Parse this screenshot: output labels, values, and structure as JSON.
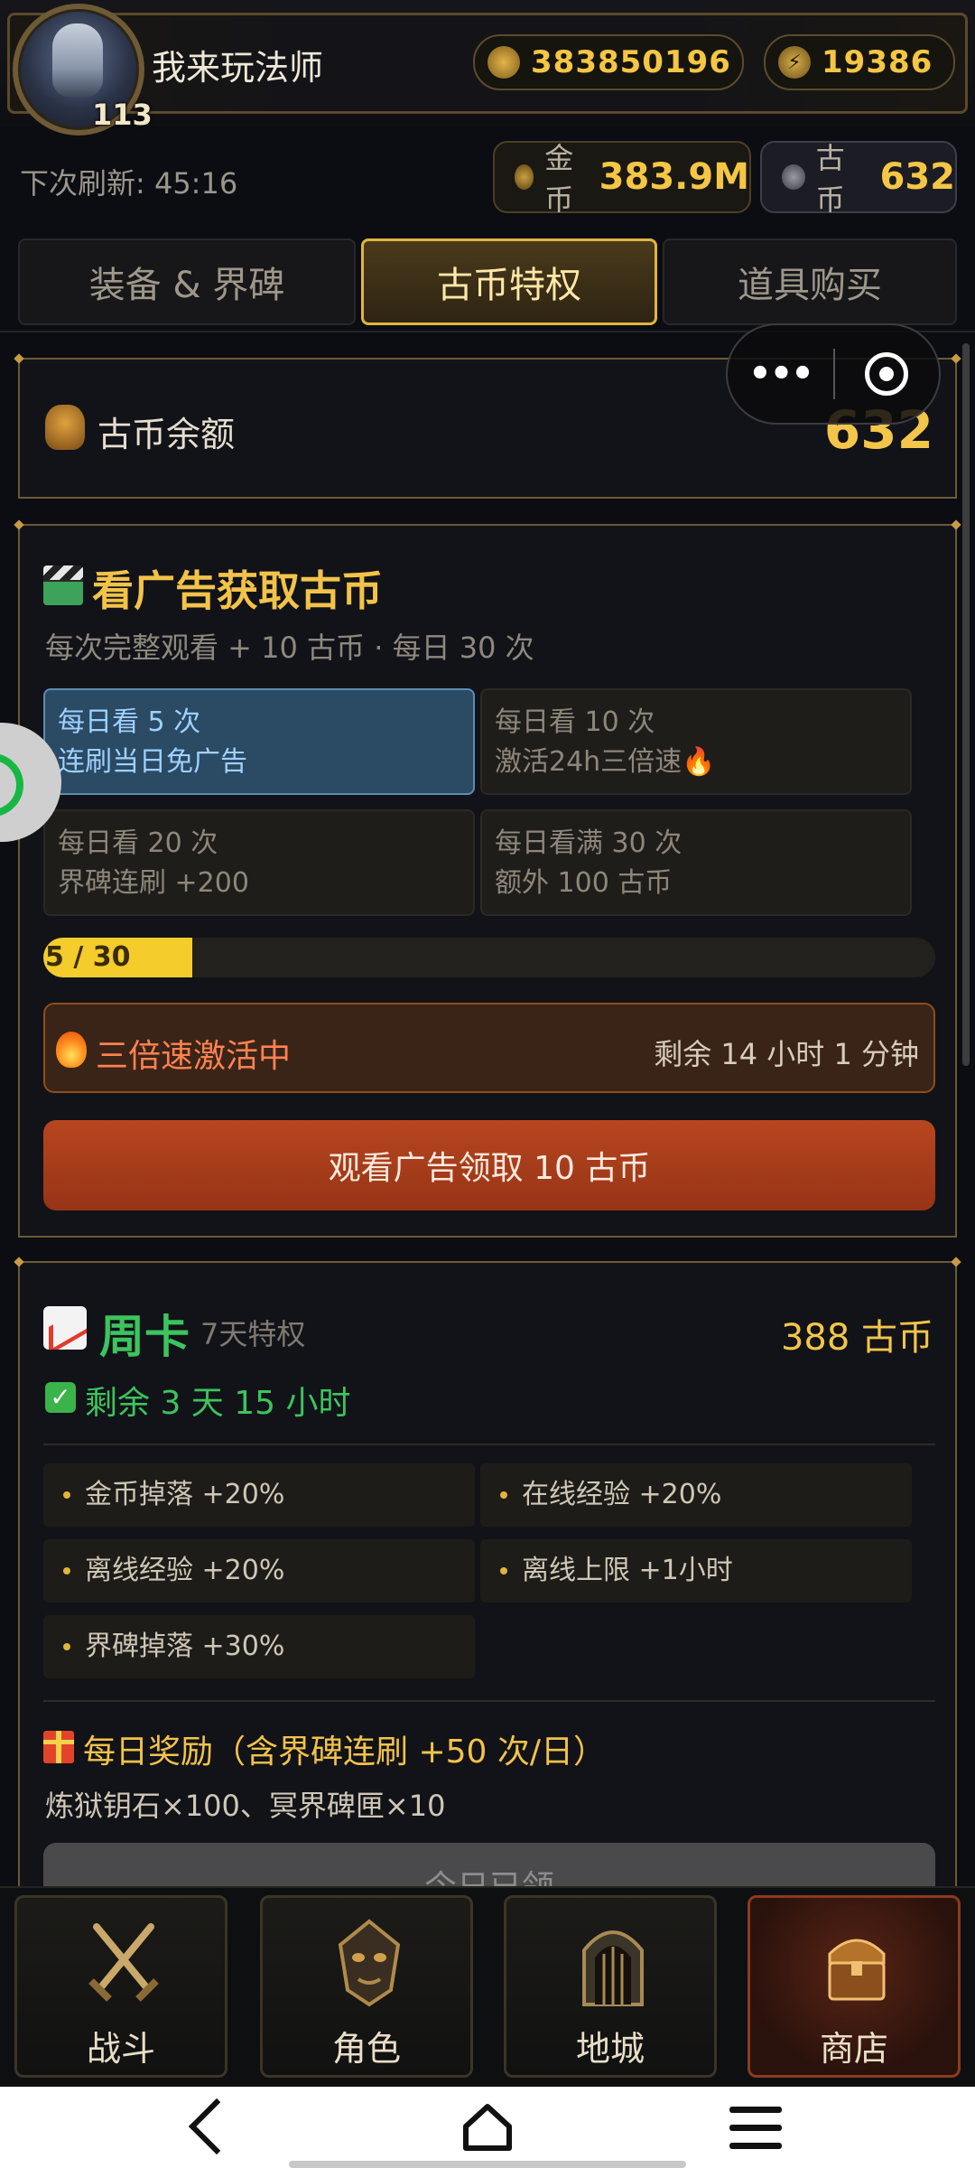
{
  "player": {
    "name": "我来玩法师",
    "level": "113",
    "gold_total": "383850196",
    "power": "19386"
  },
  "refresh": {
    "text": "下次刷新: 45:16"
  },
  "currency": {
    "gold_label": "金币",
    "gold_value": "383.9M",
    "coin_label": "古币",
    "coin_value": "632"
  },
  "tabs": [
    {
      "label": "装备 & 界碑",
      "active": false
    },
    {
      "label": "古币特权",
      "active": true
    },
    {
      "label": "道具购买",
      "active": false
    }
  ],
  "capsule": {
    "more": "•••"
  },
  "balance": {
    "label": "古币余额",
    "value": "632"
  },
  "ad": {
    "title": "看广告获取古币",
    "subtitle": "每次完整观看 + 10 古币 · 每日 30 次",
    "tiers": [
      {
        "line1": "每日看 5 次",
        "line2": "连刷当日免广告",
        "active": true
      },
      {
        "line1": "每日看 10 次",
        "line2": "激活24h三倍速🔥",
        "active": false
      },
      {
        "line1": "每日看 20 次",
        "line2": "界碑连刷 +200",
        "active": false
      },
      {
        "line1": "每日看满 30 次",
        "line2": "额外 100 古币",
        "active": false
      }
    ],
    "progress_text": "5 / 30",
    "progress_fraction": 0.1667,
    "boost_text": "三倍速激活中",
    "boost_remaining": "剩余 14 小时 1 分钟",
    "watch_button": "观看广告领取 10 古币"
  },
  "weekly": {
    "title": "周卡",
    "tag": "7天特权",
    "price": "388 古币",
    "remaining": "剩余 3 天 15 小时",
    "perks": [
      "金币掉落 +20%",
      "在线经验 +20%",
      "离线经验 +20%",
      "离线上限 +1小时",
      "界碑掉落 +30%"
    ],
    "daily_title": "每日奖励（含界碑连刷 +50 次/日）",
    "daily_items": "炼狱钥石×100、冥界碑匣×10",
    "claim_button": "今日已领"
  },
  "bottom_nav": [
    {
      "label": "战斗",
      "icon": "crossed-swords-icon",
      "active": false
    },
    {
      "label": "角色",
      "icon": "demon-mask-icon",
      "active": false
    },
    {
      "label": "地城",
      "icon": "dungeon-gate-icon",
      "active": false
    },
    {
      "label": "商店",
      "icon": "treasure-chest-icon",
      "active": true
    }
  ],
  "colors": {
    "gold_text": "#f3c54a",
    "green_text": "#3cc45e",
    "active_tab_border": "#e0b53c",
    "watch_button_bg": "#b7461f",
    "tier_active_bg": "#2b4a63"
  }
}
